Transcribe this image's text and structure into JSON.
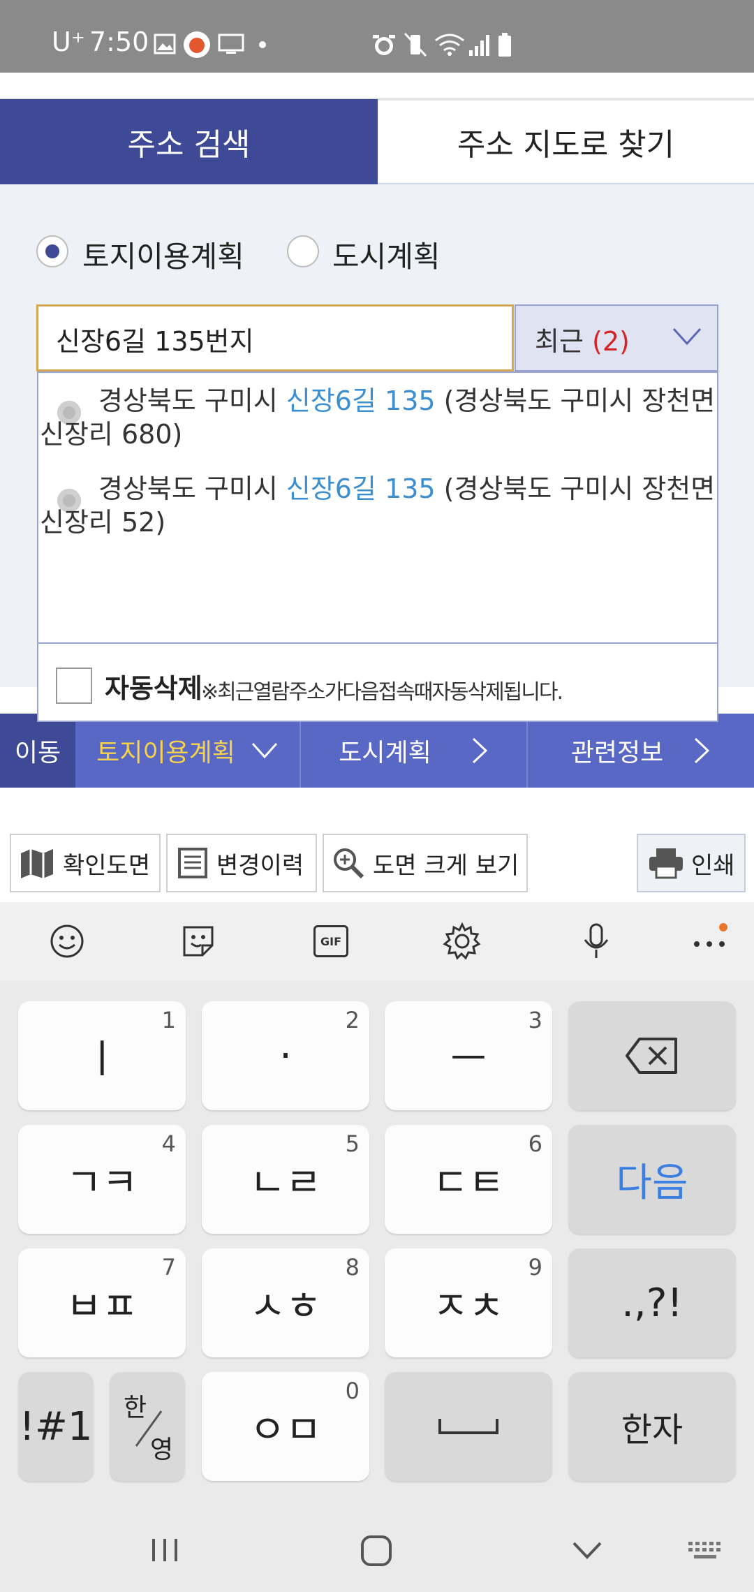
{
  "status_bar": {
    "carrier": "U⁺",
    "time": "7:50",
    "left_icons": [
      "image-icon",
      "fox-app-icon",
      "monitor-icon",
      "dot-icon"
    ],
    "right_icons": [
      "alarm-icon",
      "vibrate-icon",
      "wifi-icon",
      "signal-icon",
      "battery-icon"
    ]
  },
  "tabs": [
    {
      "label": "주소 검색",
      "active": true
    },
    {
      "label": "주소 지도로 찾기",
      "active": false
    }
  ],
  "radio_options": [
    {
      "label": "토지이용계획",
      "checked": true
    },
    {
      "label": "도시계획",
      "checked": false
    }
  ],
  "search": {
    "value": "신장6길 135번지",
    "recent_label": "최근",
    "recent_count": "(2)"
  },
  "results": [
    {
      "prefix": "경상북도 구미시 ",
      "highlight": "신장6길 135",
      "suffix": " (경상북도 구미시 장천면",
      "line2": "신장리 680)"
    },
    {
      "prefix": "경상북도 구미시 ",
      "highlight": "신장6길 135",
      "suffix": " (경상북도 구미시 장천면",
      "line2": "신장리 52)"
    }
  ],
  "auto_delete": {
    "title": "자동삭제",
    "note": "※최근열람주소가다음접속때자동삭제됩니다."
  },
  "nav": {
    "move": "이동",
    "land": "토지이용계획",
    "city": "도시계획",
    "info": "관련정보"
  },
  "toolbar": {
    "map_check": "확인도면",
    "history": "변경이력",
    "zoom": "도면 크게 보기",
    "print": "인쇄"
  },
  "keyboard": {
    "toolbar_icons": [
      "emoji-icon",
      "sticker-icon",
      "gif-icon",
      "settings-icon",
      "mic-icon",
      "more-icon"
    ],
    "gif_label": "GIF",
    "rows": [
      [
        {
          "label": "ㅣ",
          "num": "1"
        },
        {
          "label": "·",
          "num": "2"
        },
        {
          "label": "ㅡ",
          "num": "3"
        },
        {
          "label": "⌫",
          "num": ""
        }
      ],
      [
        {
          "label": "ㄱㅋ",
          "num": "4"
        },
        {
          "label": "ㄴㄹ",
          "num": "5"
        },
        {
          "label": "ㄷㅌ",
          "num": "6"
        },
        {
          "label": "다음",
          "num": ""
        }
      ],
      [
        {
          "label": "ㅂㅍ",
          "num": "7"
        },
        {
          "label": "ㅅㅎ",
          "num": "8"
        },
        {
          "label": "ㅈㅊ",
          "num": "9"
        },
        {
          "label": ".,?!",
          "num": ""
        }
      ]
    ],
    "bottom": {
      "symbols": "!#1",
      "lang_top": "한",
      "lang_bottom": "영",
      "om": "ㅇㅁ",
      "om_num": "0",
      "space": "␣",
      "hanja": "한자"
    },
    "accent_color": "#3b7fe0"
  },
  "system_nav": {
    "icons": [
      "recents-icon",
      "home-icon",
      "back-icon",
      "keyboard-icon"
    ]
  }
}
